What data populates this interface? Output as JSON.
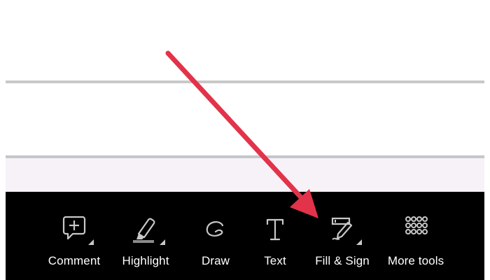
{
  "toolbar": {
    "tools": [
      {
        "label": "Comment",
        "icon": "comment-add-icon"
      },
      {
        "label": "Highlight",
        "icon": "highlight-marker-icon"
      },
      {
        "label": "Draw",
        "icon": "draw-icon"
      },
      {
        "label": "Text",
        "icon": "text-icon"
      },
      {
        "label": "Fill & Sign",
        "icon": "fill-sign-icon"
      },
      {
        "label": "More tools",
        "icon": "grid-dots-icon"
      }
    ]
  },
  "colors": {
    "toolbar_background": "#000000",
    "icon_color": "#c8c8c8",
    "label_color": "#ffffff",
    "annotation_arrow": "#e2334a",
    "divider": "#c8c8c8",
    "tint_band": "#f6f2f8"
  }
}
